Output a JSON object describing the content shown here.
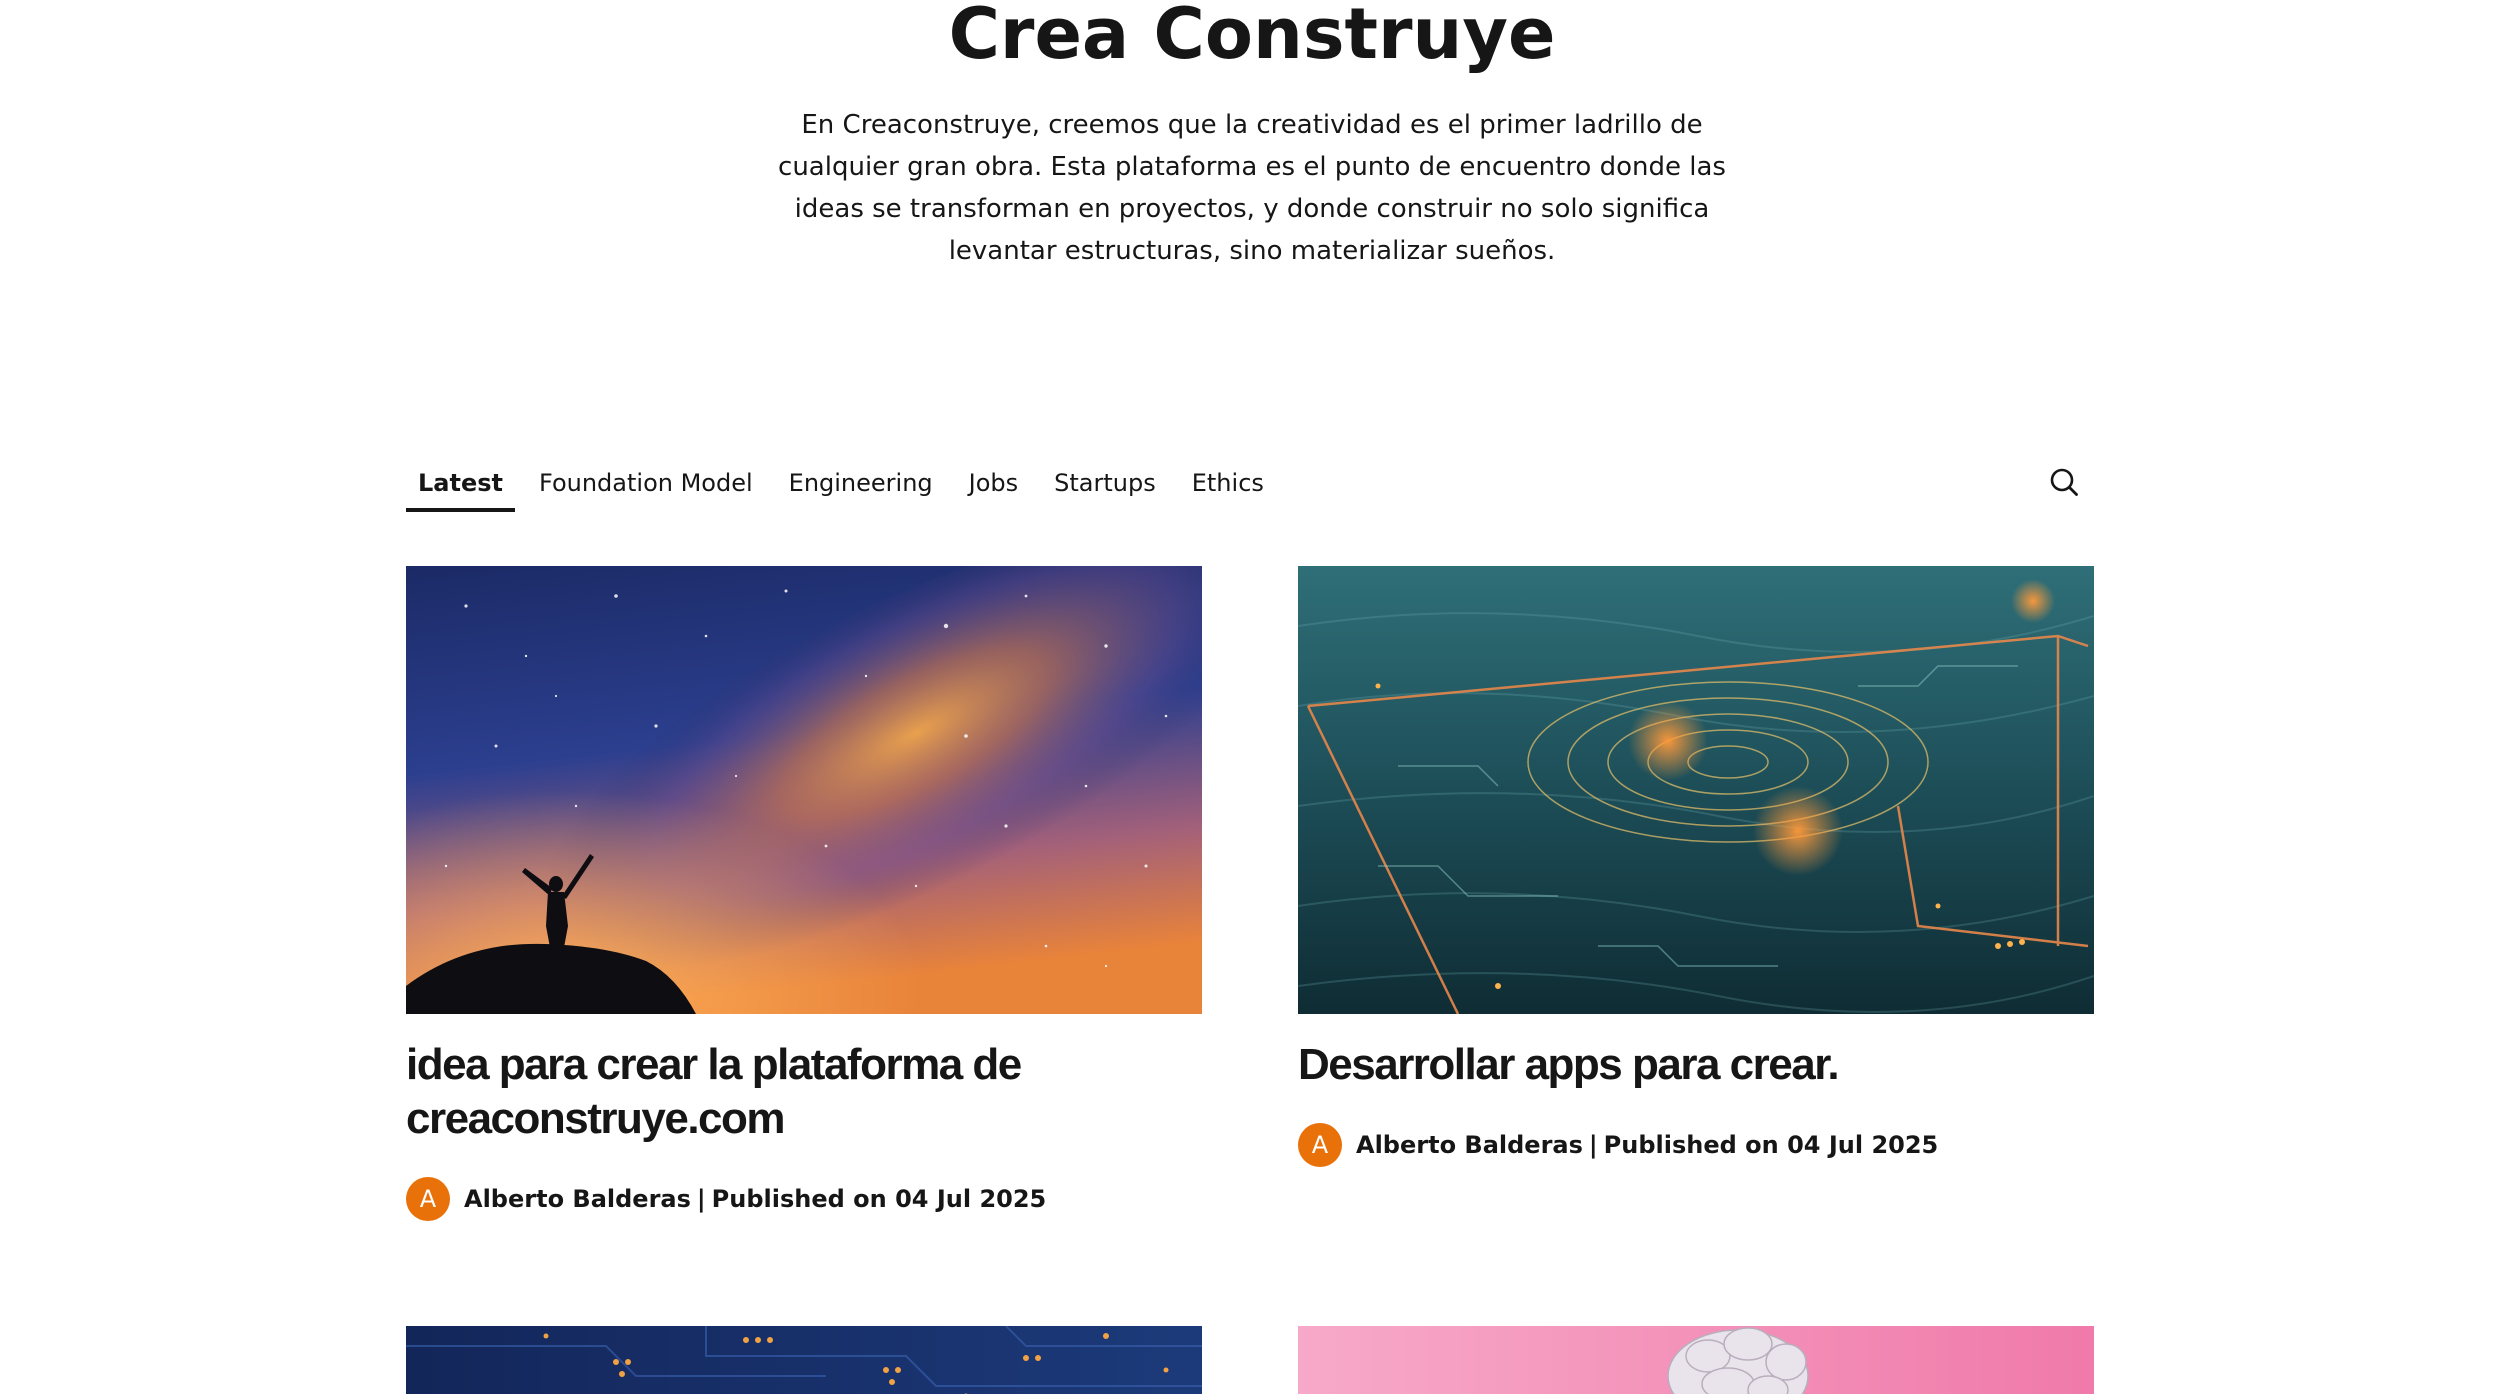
{
  "site": {
    "title": "Crea Construye",
    "description": "En Creaconstruye, creemos que la creatividad es el primer ladrillo de cualquier gran obra. Esta plataforma es el punto de encuentro donde las ideas se transforman en proyectos, y donde construir no solo significa levantar estructuras, sino materializar sueños."
  },
  "nav": {
    "tabs": [
      {
        "label": "Latest",
        "active": true
      },
      {
        "label": "Foundation Model",
        "active": false
      },
      {
        "label": "Engineering",
        "active": false
      },
      {
        "label": "Jobs",
        "active": false
      },
      {
        "label": "Startups",
        "active": false
      },
      {
        "label": "Ethics",
        "active": false
      }
    ],
    "search_icon": "search-icon"
  },
  "posts": [
    {
      "title": "idea para crear la plataforma de creaconstruye.com",
      "avatar_initial": "A",
      "author": "Alberto Balderas",
      "separator": "|",
      "published": "Published on 04 Jul 2025",
      "image": "night-sky-milky-way-silhouette"
    },
    {
      "title": "Desarrollar apps para crear.",
      "avatar_initial": "A",
      "author": "Alberto Balderas",
      "separator": "|",
      "published": "Published on 04 Jul 2025",
      "image": "circuit-topography-map"
    }
  ],
  "colors": {
    "text": "#161616",
    "avatar": "#e8710a",
    "background": "#ffffff"
  }
}
